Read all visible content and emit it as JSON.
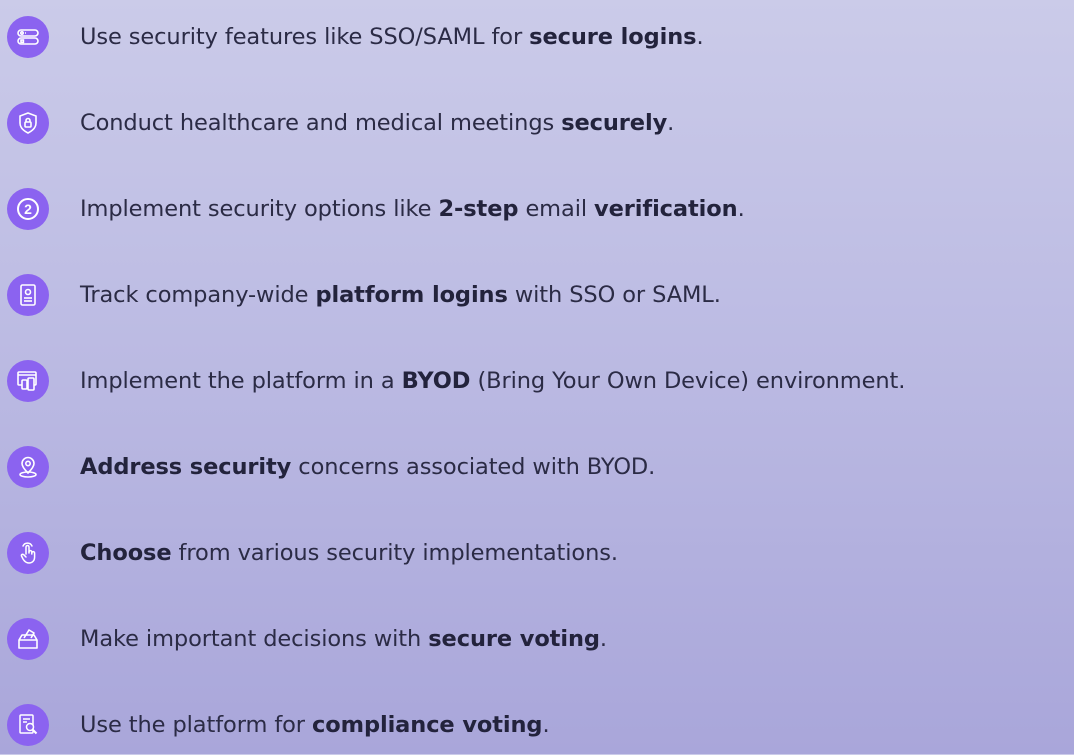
{
  "accent_color": "#8b63f0",
  "features": [
    {
      "icon": "id-cards-icon",
      "segments": [
        {
          "text": "Use security features like SSO/SAML for ",
          "bold": false
        },
        {
          "text": "secure logins",
          "bold": true
        },
        {
          "text": ".",
          "bold": false
        }
      ]
    },
    {
      "icon": "shield-lock-icon",
      "segments": [
        {
          "text": "Conduct healthcare and medical meetings ",
          "bold": false
        },
        {
          "text": "securely",
          "bold": true
        },
        {
          "text": ".",
          "bold": false
        }
      ]
    },
    {
      "icon": "two-step-icon",
      "icon_label": "2",
      "segments": [
        {
          "text": "Implement security options like ",
          "bold": false
        },
        {
          "text": "2-step",
          "bold": true
        },
        {
          "text": " email ",
          "bold": false
        },
        {
          "text": "verification",
          "bold": true
        },
        {
          "text": ".",
          "bold": false
        }
      ]
    },
    {
      "icon": "profile-window-icon",
      "segments": [
        {
          "text": "Track company-wide ",
          "bold": false
        },
        {
          "text": "platform logins",
          "bold": true
        },
        {
          "text": " with SSO or SAML.",
          "bold": false
        }
      ]
    },
    {
      "icon": "devices-icon",
      "segments": [
        {
          "text": "Implement the platform in a ",
          "bold": false
        },
        {
          "text": "BYOD",
          "bold": true
        },
        {
          "text": " (Bring Your Own Device) environment.",
          "bold": false
        }
      ]
    },
    {
      "icon": "location-pin-icon",
      "segments": [
        {
          "text": "Address security",
          "bold": true
        },
        {
          "text": " concerns associated with BYOD.",
          "bold": false
        }
      ]
    },
    {
      "icon": "hand-tap-icon",
      "segments": [
        {
          "text": "Choose",
          "bold": true
        },
        {
          "text": " from various security implementations.",
          "bold": false
        }
      ]
    },
    {
      "icon": "ballot-box-icon",
      "segments": [
        {
          "text": "Make important decisions with ",
          "bold": false
        },
        {
          "text": "secure voting",
          "bold": true
        },
        {
          "text": ".",
          "bold": false
        }
      ]
    },
    {
      "icon": "document-search-icon",
      "segments": [
        {
          "text": "Use the platform for ",
          "bold": false
        },
        {
          "text": "compliance voting",
          "bold": true
        },
        {
          "text": ".",
          "bold": false
        }
      ]
    }
  ]
}
